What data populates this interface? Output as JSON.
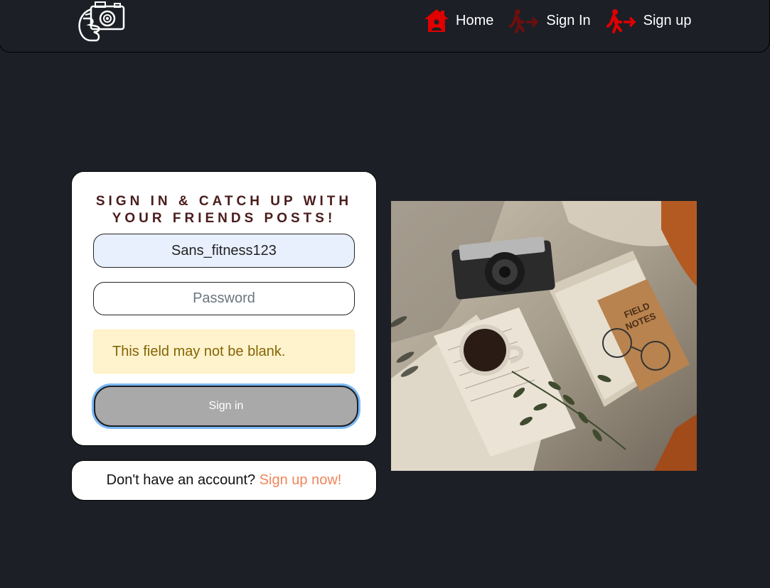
{
  "nav": {
    "logo_icon": "camera-hand-icon",
    "links": [
      {
        "label": "Home",
        "icon": "home-icon"
      },
      {
        "label": "Sign In",
        "icon": "sign-in-icon"
      },
      {
        "label": "Sign up",
        "icon": "sign-up-icon"
      }
    ],
    "icon_color": "#e00000"
  },
  "signin": {
    "heading": "Sign in & catch up with your friends posts!",
    "username_value": "Sans_fitness123",
    "password_placeholder": "Password",
    "error": "This field may not be blank.",
    "button_label": "Sign in"
  },
  "signup_prompt": {
    "text": "Don't have an account?",
    "link": "Sign up now!"
  },
  "colors": {
    "background": "#1c1f26",
    "accent_link": "#f0855a",
    "heading": "#4a1c1c",
    "alert_bg": "#fff3cd",
    "alert_text": "#856404"
  }
}
